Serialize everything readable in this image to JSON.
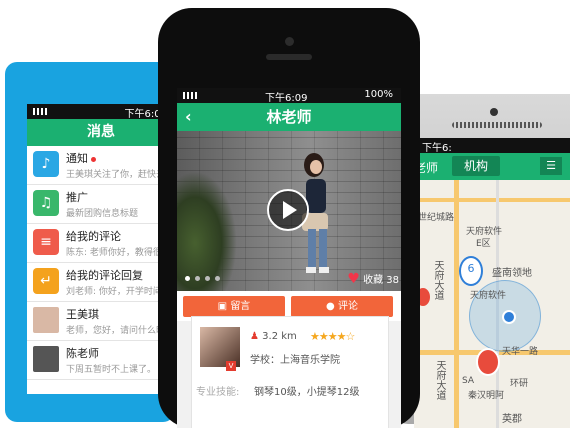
{
  "left_phone": {
    "status_time": "下午6:09",
    "header_title": "消息",
    "messages": [
      {
        "title": "通知",
        "subtitle": "王美琪关注了你，赶快去",
        "icon": "speaker-icon",
        "color": "#2aa7e4"
      },
      {
        "title": "推广",
        "subtitle": "最新团购信息标题",
        "icon": "bell-icon",
        "color": "#39b76b"
      },
      {
        "title": "给我的评论",
        "subtitle": "陈东: 老师你好，教得很",
        "icon": "comment-icon",
        "color": "#ef5b4b"
      },
      {
        "title": "给我的评论回复",
        "subtitle": "刘老师: 你好，开学时间",
        "icon": "reply-icon",
        "color": "#f4a21d"
      },
      {
        "title": "王美琪",
        "subtitle": "老师，您好，请问什么时",
        "icon": "avatar",
        "color": "#d9b8a5"
      },
      {
        "title": "陈老师",
        "subtitle": "下周五暂时不上课了。",
        "icon": "avatar",
        "color": "#555555"
      }
    ]
  },
  "center_phone": {
    "status_time": "下午6:09",
    "battery": "100%",
    "header_title": "林老师",
    "favorites_label": "收藏 38",
    "buttons": {
      "leave_message": "留言",
      "comment": "评论"
    },
    "card": {
      "distance": "3.2 km",
      "rating": 4,
      "rating_max": 5,
      "school": "学校：上海音乐学院",
      "skills_label": "专业技能:",
      "skills_value": "钢琴10级，小提琴12级"
    }
  },
  "right_phone": {
    "status_time": "下午6:",
    "tab_teacher": "老师",
    "tab_institution": "机构",
    "map_labels": [
      "世纪城路",
      "天府软件",
      "E区",
      "盛南领地",
      "天府大道",
      "天府软件",
      "天府大道",
      "天华一路",
      "SA",
      "环研",
      "秦汉明阿",
      "英郡"
    ]
  },
  "colors": {
    "green": "#1bb071",
    "orange": "#f2653a",
    "blue": "#19a3e0"
  }
}
